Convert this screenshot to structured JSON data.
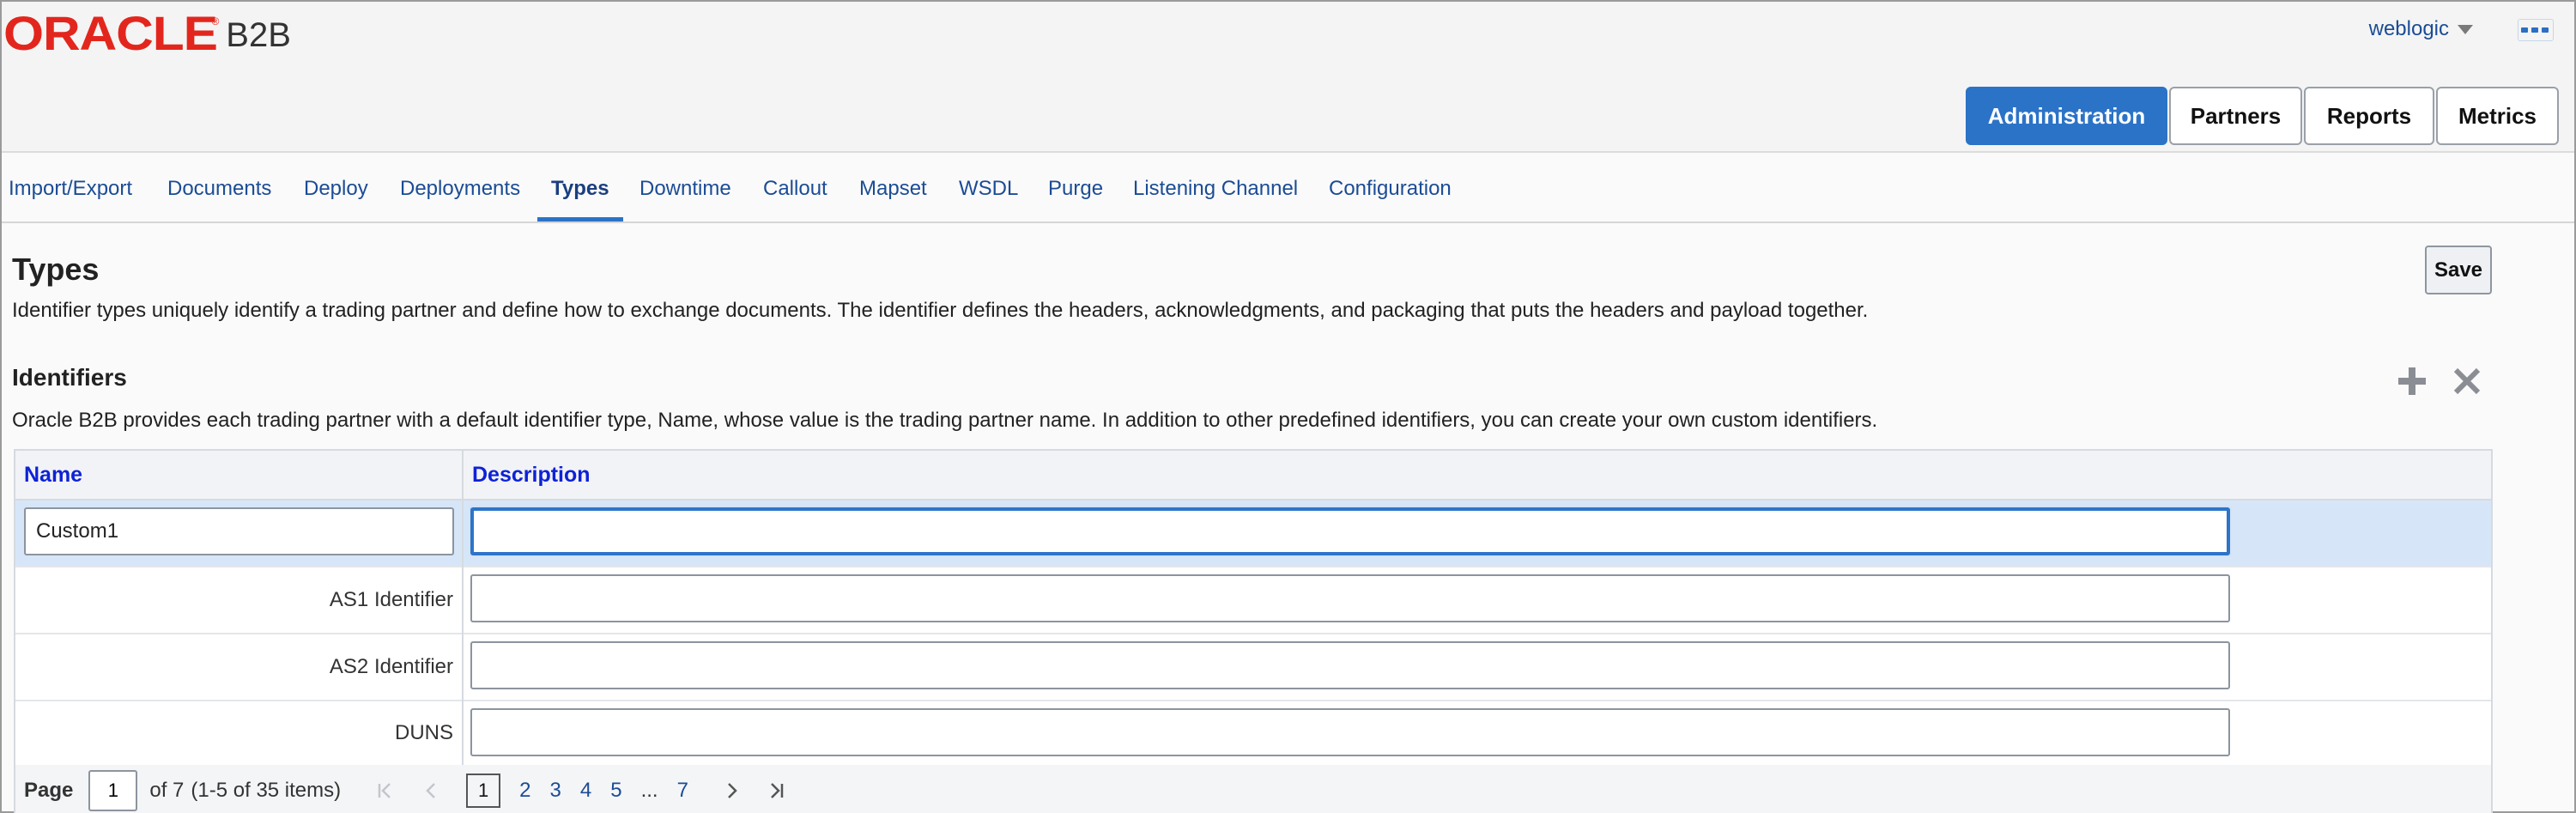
{
  "app": {
    "logo_text": "ORACLE",
    "logo_reg": "®",
    "product": "B2B",
    "brand_color": "#e3261d",
    "accent_color": "#2b73c7",
    "user": "weblogic",
    "user_menu_icon": "chevron-down-icon",
    "more_menu_icon": "more-icon"
  },
  "main_tabs": [
    {
      "label": "Administration",
      "active": true
    },
    {
      "label": "Partners",
      "active": false
    },
    {
      "label": "Reports",
      "active": false
    },
    {
      "label": "Metrics",
      "active": false
    }
  ],
  "sub_tabs": [
    {
      "label": "Import/Export",
      "active": false
    },
    {
      "label": "Documents",
      "active": false
    },
    {
      "label": "Deploy",
      "active": false
    },
    {
      "label": "Deployments",
      "active": false
    },
    {
      "label": "Types",
      "active": true
    },
    {
      "label": "Downtime",
      "active": false
    },
    {
      "label": "Callout",
      "active": false
    },
    {
      "label": "Mapset",
      "active": false
    },
    {
      "label": "WSDL",
      "active": false
    },
    {
      "label": "Purge",
      "active": false
    },
    {
      "label": "Listening Channel",
      "active": false
    },
    {
      "label": "Configuration",
      "active": false
    }
  ],
  "page": {
    "title": "Types",
    "description": "Identifier types uniquely identify a trading partner and define how to exchange documents. The identifier defines the headers, acknowledgments, and packaging that puts the headers and payload together.",
    "save_label": "Save"
  },
  "identifiers": {
    "title": "Identifiers",
    "description": "Oracle B2B provides each trading partner with a default identifier type, Name, whose value is the trading partner name. In addition to other predefined identifiers, you can create your own custom identifiers.",
    "add_icon": "plus-icon",
    "delete_icon": "close-icon",
    "columns": [
      "Name",
      "Description"
    ],
    "rows": [
      {
        "name": "Custom1",
        "editable_name": true,
        "description": "",
        "selected": true
      },
      {
        "name": "AS1 Identifier",
        "editable_name": false,
        "description": "",
        "selected": false
      },
      {
        "name": "AS2 Identifier",
        "editable_name": false,
        "description": "",
        "selected": false
      },
      {
        "name": "DUNS",
        "editable_name": false,
        "description": "",
        "selected": false
      }
    ],
    "pager": {
      "page_label": "Page",
      "current_page": "1",
      "of_text": "of 7",
      "range_text": "(1-5 of 35 items)",
      "pages": [
        "1",
        "2",
        "3",
        "4",
        "5"
      ],
      "ellipsis": "...",
      "last_page": "7"
    }
  }
}
